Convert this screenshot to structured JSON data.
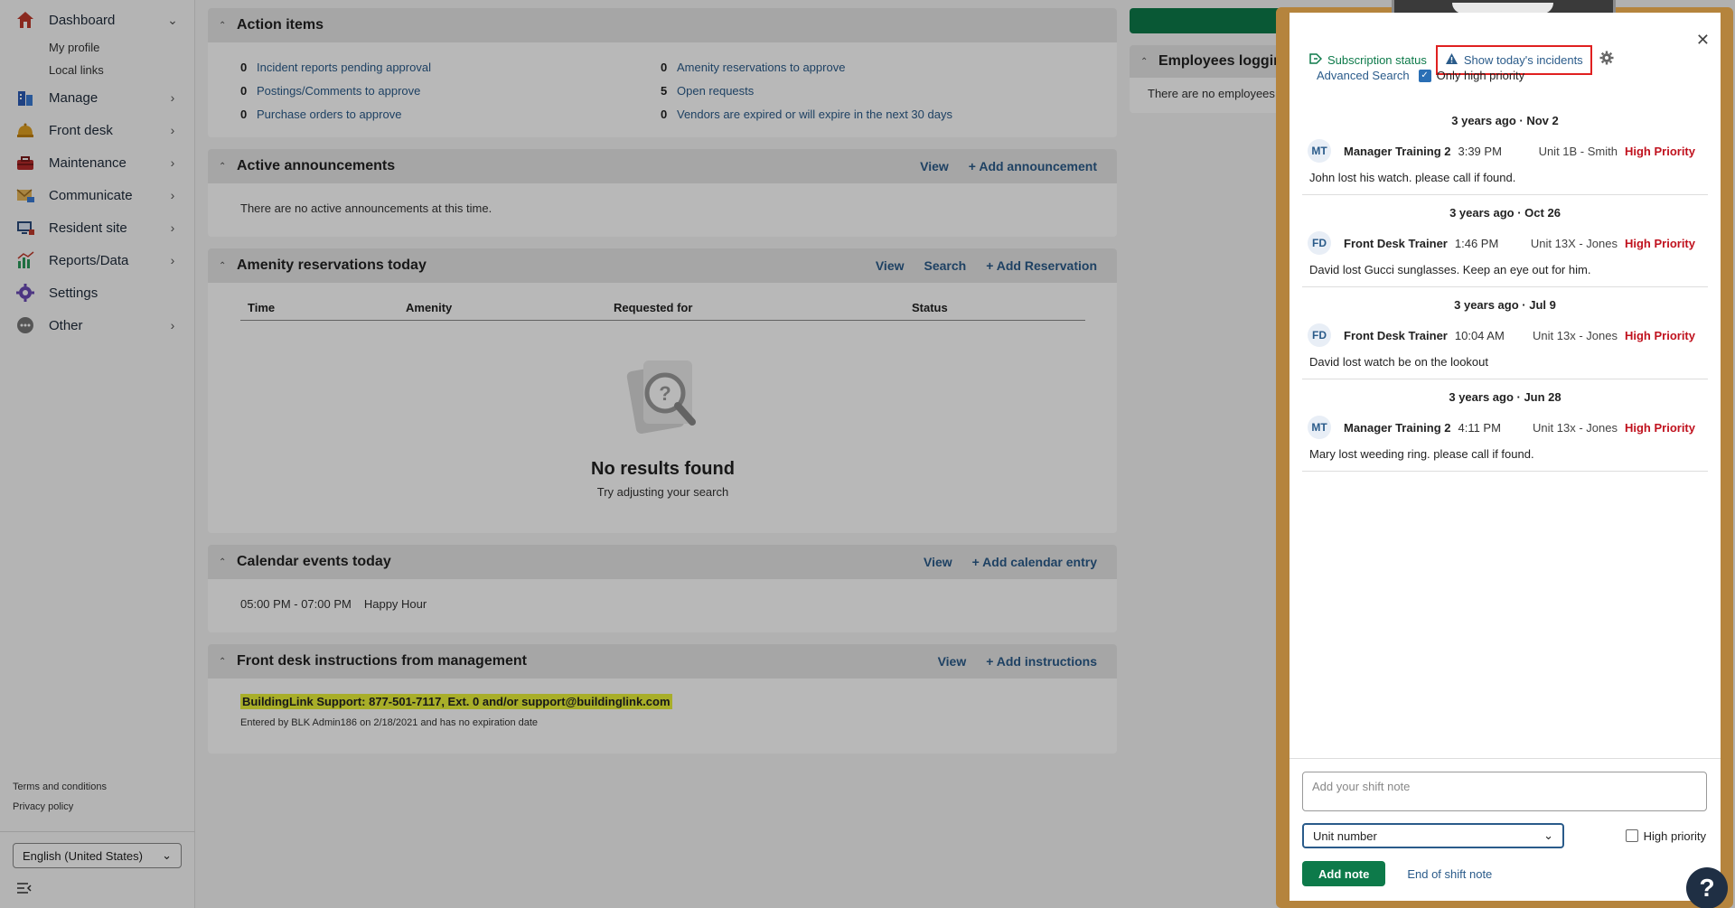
{
  "sidebar": {
    "items": [
      {
        "label": "Dashboard",
        "icon": "home-icon",
        "chevron": "⌄"
      },
      {
        "label": "Manage",
        "icon": "building-icon",
        "chevron": "›"
      },
      {
        "label": "Front desk",
        "icon": "bell-icon",
        "chevron": "›"
      },
      {
        "label": "Maintenance",
        "icon": "toolbox-icon",
        "chevron": "›"
      },
      {
        "label": "Communicate",
        "icon": "mail-icon",
        "chevron": "›"
      },
      {
        "label": "Resident site",
        "icon": "monitor-icon",
        "chevron": "›"
      },
      {
        "label": "Reports/Data",
        "icon": "chart-icon",
        "chevron": "›"
      },
      {
        "label": "Settings",
        "icon": "gear-icon",
        "chevron": ""
      },
      {
        "label": "Other",
        "icon": "more-icon",
        "chevron": "›"
      }
    ],
    "sub_items": [
      "My profile",
      "Local links"
    ],
    "legal": [
      "Terms and conditions",
      "Privacy policy"
    ],
    "language": "English (United States)"
  },
  "action_items": {
    "title": "Action items",
    "left": [
      {
        "count": "0",
        "label": "Incident reports pending approval"
      },
      {
        "count": "0",
        "label": "Postings/Comments to approve"
      },
      {
        "count": "0",
        "label": "Purchase orders to approve"
      }
    ],
    "right": [
      {
        "count": "0",
        "label": "Amenity reservations to approve"
      },
      {
        "count": "5",
        "label": "Open requests"
      },
      {
        "count": "0",
        "label": "Vendors are expired or will expire in the next 30 days"
      }
    ]
  },
  "announcements": {
    "title": "Active announcements",
    "links": [
      "View",
      "+ Add announcement"
    ],
    "empty": "There are no active announcements at this time."
  },
  "amenity": {
    "title": "Amenity reservations today",
    "links": [
      "View",
      "Search",
      "+ Add Reservation"
    ],
    "columns": [
      "Time",
      "Amenity",
      "Requested for",
      "Status"
    ],
    "no_results": "No results found",
    "hint": "Try adjusting your search"
  },
  "calendar": {
    "title": "Calendar events today",
    "links": [
      "View",
      "+ Add calendar entry"
    ],
    "time": "05:00 PM - 07:00 PM",
    "event": "Happy Hour"
  },
  "front_desk": {
    "title": "Front desk instructions from management",
    "links": [
      "View",
      "+ Add instructions"
    ],
    "highlight": "BuildingLink Support: 877-501-7117, Ext. 0 and/or support@buildinglink.com",
    "meta": "Entered by BLK Admin186 on 2/18/2021 and has no expiration date"
  },
  "employees": {
    "title": "Employees loggin",
    "empty": "There are no employees l"
  },
  "shift_log": {
    "subscription_status": "Subscription status",
    "show_today": "Show today's incidents",
    "advanced_search": "Advanced Search",
    "only_high_priority": "Only high priority",
    "notes": [
      {
        "date": "3 years ago · Nov 2",
        "initials": "MT",
        "author": "Manager Training 2",
        "time": "3:39 PM",
        "unit": "Unit 1B - Smith",
        "priority": "High Priority",
        "text": "John lost his watch. please call if found."
      },
      {
        "date": "3 years ago · Oct 26",
        "initials": "FD",
        "author": "Front Desk Trainer",
        "time": "1:46 PM",
        "unit": "Unit 13X - Jones",
        "priority": "High Priority",
        "text": "David lost Gucci sunglasses. Keep an eye out for him."
      },
      {
        "date": "3 years ago · Jul 9",
        "initials": "FD",
        "author": "Front Desk Trainer",
        "time": "10:04 AM",
        "unit": "Unit 13x - Jones",
        "priority": "High Priority",
        "text": "David lost watch be on the lookout"
      },
      {
        "date": "3 years ago · Jun 28",
        "initials": "MT",
        "author": "Manager Training 2",
        "time": "4:11 PM",
        "unit": "Unit 13x - Jones",
        "priority": "High Priority",
        "text": "Mary lost weeding ring. please call if found."
      }
    ],
    "shift_placeholder": "Add your shift note",
    "unit_select": "Unit number",
    "high_priority": "High priority",
    "add_note": "Add note",
    "end_of_shift": "End of shift note"
  },
  "help": "?",
  "colors": {
    "brand_green": "#0d7a4a",
    "link_blue": "#2a5b8a",
    "priority_red": "#c0121e",
    "clipboard": "#b5843d"
  }
}
